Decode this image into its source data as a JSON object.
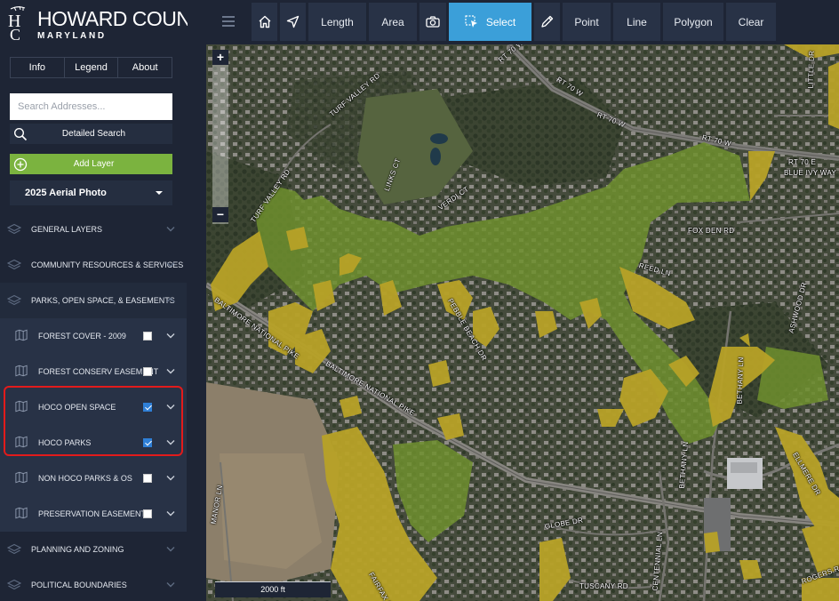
{
  "logo": {
    "title": "HOWARD COUNTY",
    "subtitle": "MARYLAND",
    "mark": "HC"
  },
  "toolbar": {
    "length": "Length",
    "area": "Area",
    "select": "Select",
    "point": "Point",
    "line": "Line",
    "polygon": "Polygon",
    "clear": "Clear"
  },
  "tabs": [
    "Info",
    "Legend",
    "About"
  ],
  "search": {
    "placeholder": "Search Addresses...",
    "value": "",
    "detailed_label": "Detailed Search"
  },
  "add_layer_label": "Add Layer",
  "basemap": {
    "selected": "2025 Aerial Photo"
  },
  "groups": [
    {
      "label": "GENERAL LAYERS"
    },
    {
      "label": "COMMUNITY RESOURCES & SERVICES"
    },
    {
      "label": "PARKS, OPEN SPACE, & EASEMENTS"
    }
  ],
  "layers": [
    {
      "label": "FOREST COVER - 2009",
      "checked": false
    },
    {
      "label": "FOREST CONSERV EASEMENT",
      "checked": false
    },
    {
      "label": "HOCO OPEN SPACE",
      "checked": true
    },
    {
      "label": "HOCO PARKS",
      "checked": true
    },
    {
      "label": "NON HOCO PARKS & OS",
      "checked": false
    },
    {
      "label": "PRESERVATION EASEMENTS",
      "checked": false
    }
  ],
  "groups_after": [
    {
      "label": "PLANNING AND ZONING"
    },
    {
      "label": "POLITICAL BOUNDARIES"
    }
  ],
  "map": {
    "zoom_in": "+",
    "zoom_out": "−",
    "scale_label": "2000 ft",
    "roads": [
      "RT 70 W",
      "RT 70 W",
      "RT 70 W",
      "RT 70 W",
      "RT 70 E",
      "BLUE IVY WAY",
      "TURF VALLEY RD",
      "TURF VALLEY RD",
      "LINKS CT",
      "VERDI CT",
      "FOX DEN RD",
      "REED LN",
      "PEBBLE BEACH DR",
      "BALTIMORE NATIONAL PIKE",
      "BALTIMORE NATIONAL PIKE",
      "ASHWOOD DR",
      "BETHANY LN",
      "BETHANY LN",
      "CENTENNIAL LN",
      "GLOBE DR",
      "TUSCANY RD",
      "FAIRFAX RD",
      "MANOR LN",
      "LITTLE DR",
      "ELLMERE DR",
      "ROGERS RD"
    ],
    "colors": {
      "open_space": "#b8a227",
      "parks": "#6e8f2e",
      "imagery": "#4a5040"
    }
  }
}
